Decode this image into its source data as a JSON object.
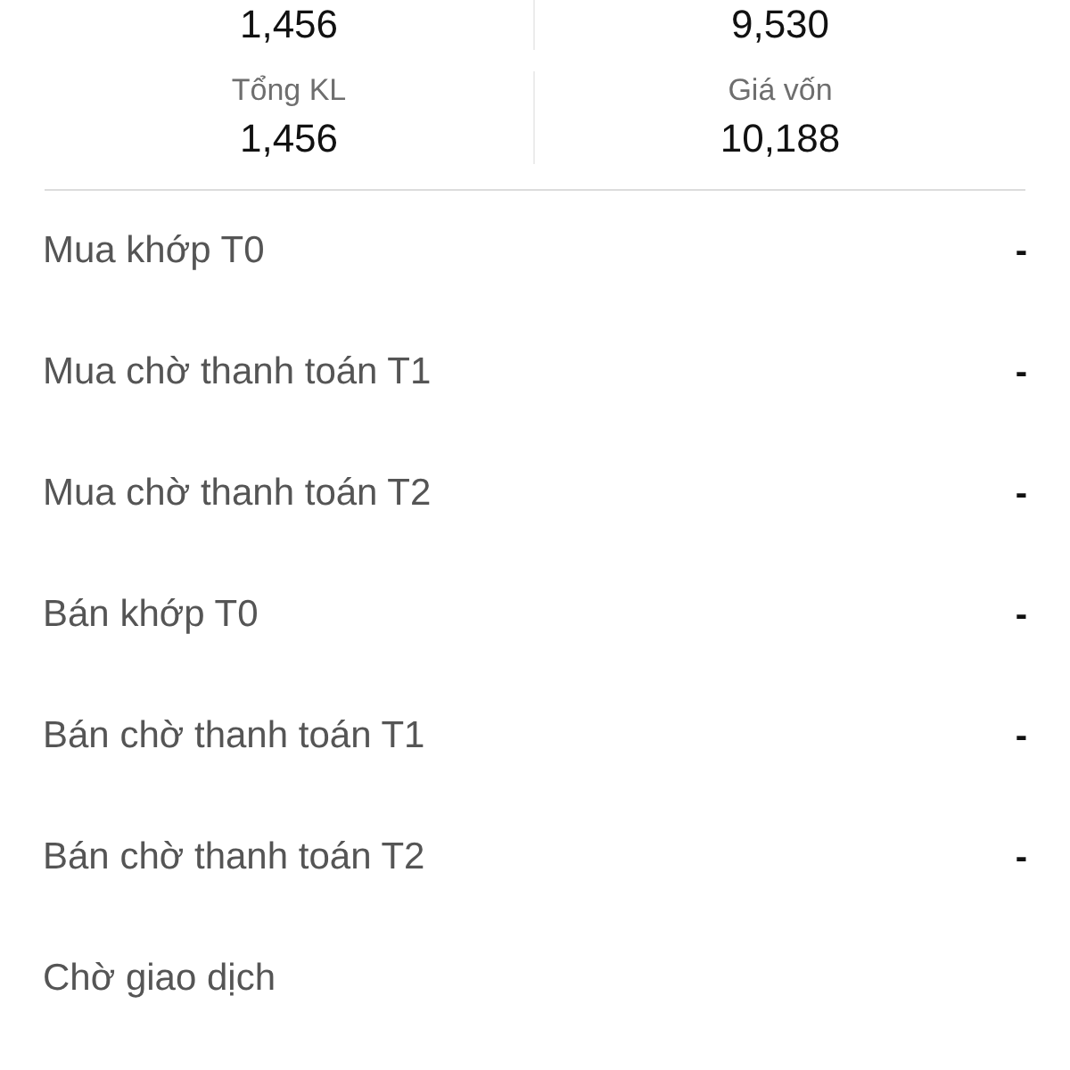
{
  "stats": [
    {
      "cells": [
        {
          "value": "1,456"
        },
        {
          "value": "9,530"
        }
      ]
    },
    {
      "cells": [
        {
          "label": "Tổng KL",
          "value": "1,456"
        },
        {
          "label": "Giá vốn",
          "value": "10,188"
        }
      ]
    }
  ],
  "details": [
    {
      "label": "Mua khớp T0",
      "value": "-"
    },
    {
      "label": "Mua chờ thanh toán T1",
      "value": "-"
    },
    {
      "label": "Mua chờ thanh toán T2",
      "value": "-"
    },
    {
      "label": "Bán khớp T0",
      "value": "-"
    },
    {
      "label": "Bán chờ thanh toán T1",
      "value": "-"
    },
    {
      "label": "Bán chờ thanh toán T2",
      "value": "-"
    },
    {
      "label": "Chờ giao dịch"
    }
  ]
}
